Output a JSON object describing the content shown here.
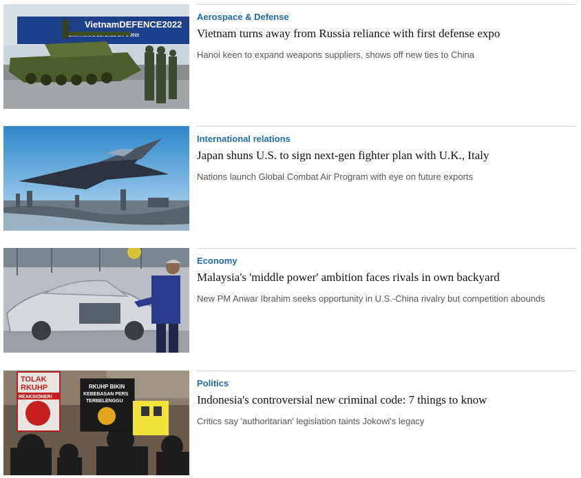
{
  "articles": [
    {
      "category": "Aerospace & Defense",
      "headline": "Vietnam turns away from Russia reliance with first defense expo",
      "summary": "Hanoi keen to expand weapons suppliers, shows off new ties to China",
      "image_text": {
        "banner_main": "VietnamDEFENCE2022",
        "banner_sub": "INTERNATIONAL DEFENCE EXPO 2022"
      }
    },
    {
      "category": "International relations",
      "headline": "Japan shuns U.S. to sign next-gen fighter plan with U.K., Italy",
      "summary": "Nations launch Global Combat Air Program with eye on future exports"
    },
    {
      "category": "Economy",
      "headline": "Malaysia's 'middle power' ambition faces rivals in own backyard",
      "summary": "New PM Anwar Ibrahim seeks opportunity in U.S.-China rivalry but competition abounds"
    },
    {
      "category": "Politics",
      "headline": "Indonesia's controversial new criminal code: 7 things to know",
      "summary": "Critics say 'authoritarian' legislation taints Jokowi's legacy",
      "image_text": {
        "sign1_l1": "TOLAK",
        "sign1_l2": "RKUHP",
        "sign1_l3": "REAKSIONER!",
        "sign2_l1": "RKUHP BIKIN",
        "sign2_l2": "KEBEBASAN PERS",
        "sign2_l3": "TERBELENGGU"
      }
    }
  ],
  "colors": {
    "category": "#1f6aa5",
    "headline": "#111111",
    "summary": "#555555",
    "divider": "#d4d4d4"
  }
}
